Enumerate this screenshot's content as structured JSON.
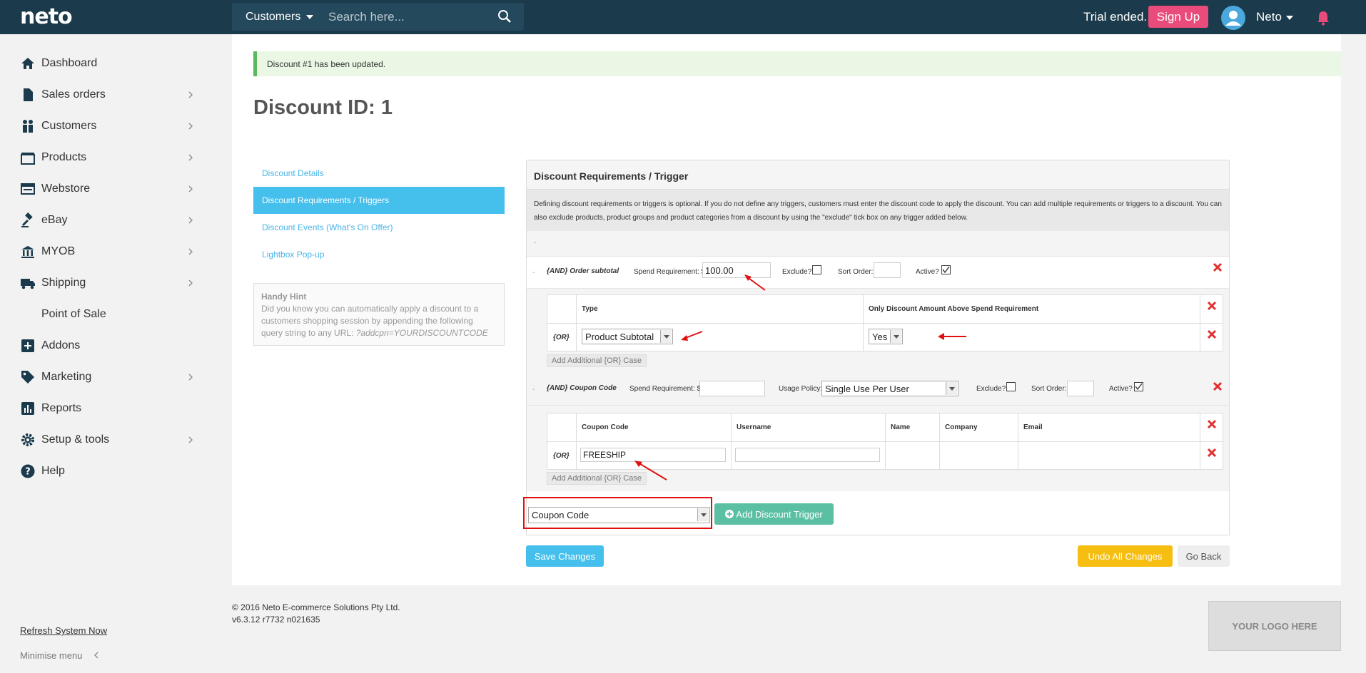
{
  "brand": {
    "logo": "neto"
  },
  "header": {
    "search_category": "Customers",
    "search_placeholder": "Search here...",
    "trial_text": "Trial ended.",
    "signup_label": "Sign Up",
    "user_name": "Neto"
  },
  "sidebar": {
    "items": [
      {
        "label": "Dashboard",
        "icon": "home-icon"
      },
      {
        "label": "Sales orders",
        "icon": "file-icon"
      },
      {
        "label": "Customers",
        "icon": "people-icon"
      },
      {
        "label": "Products",
        "icon": "box-icon"
      },
      {
        "label": "Webstore",
        "icon": "window-icon"
      },
      {
        "label": "eBay",
        "icon": "gavel-icon"
      },
      {
        "label": "MYOB",
        "icon": "bank-icon"
      },
      {
        "label": "Shipping",
        "icon": "truck-icon"
      },
      {
        "label": "Point of Sale",
        "icon": "store-icon"
      },
      {
        "label": "Addons",
        "icon": "plus-square-icon"
      },
      {
        "label": "Marketing",
        "icon": "tag-icon"
      },
      {
        "label": "Reports",
        "icon": "chart-icon"
      },
      {
        "label": "Setup & tools",
        "icon": "gear-icon"
      },
      {
        "label": "Help",
        "icon": "question-icon"
      }
    ],
    "refresh_label": "Refresh System Now",
    "minimise_label": "Minimise menu"
  },
  "alert": {
    "message": "Discount #1 has been updated."
  },
  "page": {
    "title": "Discount ID: 1"
  },
  "subnav": {
    "items": [
      "Discount Details",
      "Discount Requirements / Triggers",
      "Discount Events (What's On Offer)",
      "Lightbox Pop-up"
    ],
    "active_index": 1
  },
  "hint": {
    "title": "Handy Hint",
    "text": "Did you know you can automatically apply a discount to a customers shopping session by appending the following query string to any URL: ",
    "code": "?addcpn=YOURDISCOUNTCODE"
  },
  "panel": {
    "title": "Discount Requirements / Trigger",
    "description": "Defining discount requirements or triggers is optional. If you do not define any triggers, customers must enter the discount code to apply the discount. You can add multiple requirements or triggers to a discount. You can also exclude products, product groups and product categories from a discount by using the \"exclude\" tick box on any trigger added below.",
    "dash": "-"
  },
  "trigger1": {
    "dash": "-",
    "label": "{AND} Order subtotal",
    "spend_label": "Spend Requirement: $",
    "spend_value": "100.00",
    "exclude_label": "Exclude?",
    "sort_label": "Sort Order:",
    "active_label": "Active?",
    "col_type": "Type",
    "col_only": "Only Discount Amount Above Spend Requirement",
    "or_label": "{OR}",
    "type_value": "Product Subtotal",
    "only_value": "Yes",
    "add_case": "Add Additional {OR} Case"
  },
  "trigger2": {
    "dash": "-",
    "label": "{AND} Coupon Code",
    "spend_label": "Spend Requirement: $",
    "usage_label": "Usage Policy:",
    "usage_value": "Single Use Per User",
    "exclude_label": "Exclude?",
    "sort_label": "Sort Order:",
    "active_label": "Active?",
    "cols": [
      "Coupon Code",
      "Username",
      "Name",
      "Company",
      "Email"
    ],
    "or_label": "{OR}",
    "coupon_value": "FREESHIP",
    "add_case": "Add Additional {OR} Case"
  },
  "add_trigger": {
    "select_value": "Coupon Code",
    "button_label": "Add Discount Trigger"
  },
  "actions": {
    "save": "Save Changes",
    "undo": "Undo All Changes",
    "back": "Go Back"
  },
  "footer": {
    "copyright": "© 2016 Neto E-commerce Solutions Pty Ltd.",
    "version": "v6.3.12 r7732 n021635",
    "logo_placeholder": "YOUR LOGO HERE"
  },
  "colors": {
    "topbar": "#1b3a4b",
    "accent": "#45bfec",
    "signup": "#e94c7b",
    "add_trigger": "#5bc0a3",
    "undo": "#f6be11",
    "delete": "#e03030"
  }
}
